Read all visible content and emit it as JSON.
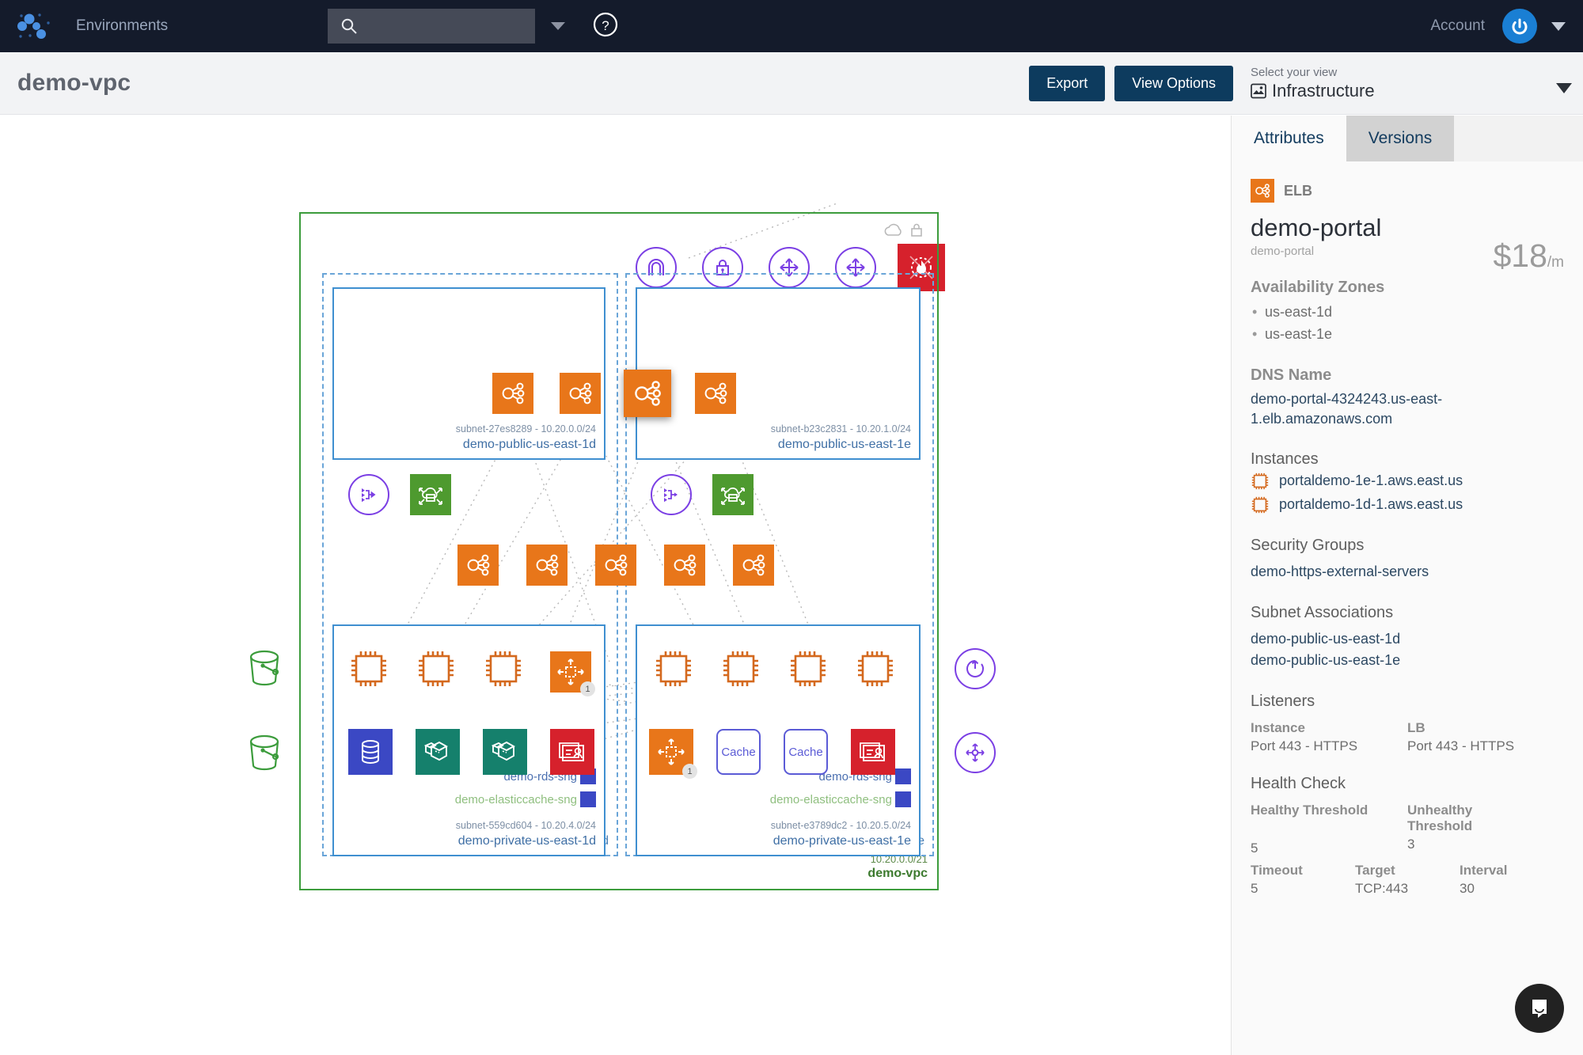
{
  "topnav": {
    "brand_icon": "network-logo-icon",
    "environments_label": "Environments",
    "search_placeholder": "",
    "search_value": "",
    "help_icon": "question-circle-icon",
    "account_label": "Account",
    "avatar_icon": "user-avatar-icon"
  },
  "subheader": {
    "title": "demo-vpc",
    "export_label": "Export",
    "view_options_label": "View Options",
    "view_select_label": "Select your view",
    "view_select_value": "Infrastructure",
    "view_select_icon": "image-view-icon"
  },
  "left_controls": [
    {
      "name": "zoom-in-button",
      "glyph": "+"
    },
    {
      "name": "zoom-out-button",
      "glyph": "−"
    },
    {
      "name": "fit-to-screen-button",
      "glyph": "map-fit-icon"
    },
    {
      "name": "center-button",
      "glyph": "center-dot-icon"
    }
  ],
  "diagram": {
    "top_icons": [
      {
        "name": "internet-gateway-icon",
        "label": "Internet Gateway",
        "style": "purple-circle"
      },
      {
        "name": "vpn-gateway-icon",
        "label": "VPN Gateway",
        "style": "purple-circle"
      },
      {
        "name": "router-icon",
        "label": "Router",
        "style": "purple-circle"
      },
      {
        "name": "router-icon-2",
        "label": "Router",
        "style": "purple-circle"
      },
      {
        "name": "waf-firewall-icon",
        "label": "WAF",
        "style": "red-square"
      }
    ],
    "side_icons": [
      {
        "name": "s3-bucket-icon",
        "label": "S3 Bucket"
      },
      {
        "name": "s3-bucket-icon-2",
        "label": "S3 Bucket"
      },
      {
        "name": "elastic-ip-icon",
        "label": "Elastic IP"
      },
      {
        "name": "route-table-icon",
        "label": "Route Table"
      }
    ],
    "vpc": {
      "cidr": "10.20.0.0/21",
      "name": "demo-vpc",
      "corner_icons": [
        "cloud-icon",
        "lock-icon"
      ]
    },
    "elb_row_top": [
      {
        "name": "elb-1",
        "selected": false
      },
      {
        "name": "elb-2",
        "selected": false
      },
      {
        "name": "elb-3",
        "selected": true
      },
      {
        "name": "elb-4",
        "selected": false
      }
    ],
    "elb_row_mid": [
      {
        "name": "elb-5"
      },
      {
        "name": "elb-6"
      },
      {
        "name": "elb-7"
      },
      {
        "name": "elb-8"
      },
      {
        "name": "elb-9"
      }
    ],
    "availability_zones": [
      {
        "label": "us-east-1d",
        "public_subnet": {
          "id": "subnet-27es8289 - 10.20.0.0/24",
          "name": "demo-public-us-east-1d"
        },
        "private_subnet": {
          "id": "subnet-559cd604 - 10.20.4.0/24",
          "name": "demo-private-us-east-1d"
        },
        "public_resources": [
          {
            "name": "nat-gateway-icon",
            "style": "purple-circle"
          },
          {
            "name": "cloud-storage-icon",
            "style": "green-square"
          }
        ],
        "private_instances": [
          "ec2-instance",
          "ec2-instance",
          "ec2-instance"
        ],
        "autoscaling_badge": "1",
        "private_services": [
          "rds-database-icon",
          "ecs-container-icon",
          "ecs-container-icon",
          "directory-service-icon"
        ],
        "subnet_groups": [
          {
            "label": "demo-rds-sng",
            "icon": "rds-subnet-group-icon",
            "color": "#4a6fb0"
          },
          {
            "label": "demo-elasticcache-sng",
            "icon": "elasticache-subnet-group-icon",
            "color": "#8fbf7f"
          }
        ]
      },
      {
        "label": "us-east-1e",
        "public_subnet": {
          "id": "subnet-b23c2831 - 10.20.1.0/24",
          "name": "demo-public-us-east-1e"
        },
        "private_subnet": {
          "id": "subnet-e3789dc2 - 10.20.5.0/24",
          "name": "demo-private-us-east-1e"
        },
        "public_resources": [
          {
            "name": "nat-gateway-icon",
            "style": "purple-circle"
          },
          {
            "name": "cloud-storage-icon",
            "style": "green-square"
          }
        ],
        "private_instances": [
          "ec2-instance",
          "ec2-instance",
          "ec2-instance",
          "ec2-instance"
        ],
        "autoscaling_badge": "1",
        "private_services": [
          "autoscaling-group-icon",
          "cache-node",
          "cache-node",
          "directory-service-icon"
        ],
        "cache_label": "Cache",
        "subnet_groups": [
          {
            "label": "demo-rds-sng",
            "icon": "rds-subnet-group-icon",
            "color": "#4a6fb0"
          },
          {
            "label": "demo-elasticcache-sng",
            "icon": "elasticache-subnet-group-icon",
            "color": "#8fbf7f"
          }
        ]
      }
    ]
  },
  "panel": {
    "tabs": [
      {
        "label": "Attributes",
        "active": true
      },
      {
        "label": "Versions",
        "active": false
      }
    ],
    "resource_type": "ELB",
    "resource_type_icon": "elb-icon",
    "resource_name": "demo-portal",
    "resource_subname": "demo-portal",
    "price": "$18",
    "price_unit": "/m",
    "availability_zones_heading": "Availability Zones",
    "availability_zones": [
      "us-east-1d",
      "us-east-1e"
    ],
    "dns_heading": "DNS Name",
    "dns_value": "demo-portal-4324243.us-east-1.elb.amazonaws.com",
    "instances_heading": "Instances",
    "instances": [
      "portaldemo-1e-1.aws.east.us",
      "portaldemo-1d-1.aws.east.us"
    ],
    "security_groups_heading": "Security Groups",
    "security_groups": [
      "demo-https-external-servers"
    ],
    "subnet_assoc_heading": "Subnet Associations",
    "subnet_associations": [
      "demo-public-us-east-1d",
      "demo-public-us-east-1e"
    ],
    "listeners_heading": "Listeners",
    "listeners": [
      {
        "header": "Instance",
        "value": "Port 443 - HTTPS"
      },
      {
        "header": "LB",
        "value": "Port 443 - HTTPS"
      }
    ],
    "health_check_heading": "Health Check",
    "health_check_row1": [
      {
        "header": "Healthy Threshold",
        "value": "5"
      },
      {
        "header": "Unhealthy Threshold",
        "value": "3"
      }
    ],
    "health_check_row2": [
      {
        "header": "Timeout",
        "value": "5"
      },
      {
        "header": "Target",
        "value": "TCP:443"
      },
      {
        "header": "Interval",
        "value": "30"
      }
    ],
    "chat_icon": "chat-bubble-icon"
  },
  "colors": {
    "nav_bg": "#141b2b",
    "accent_blue": "#0d3b5e",
    "aws_orange": "#e8761a",
    "vpc_green": "#3c9c3c",
    "subnet_blue": "#3f8fd0",
    "purple": "#7b3fe4",
    "red": "#d6212c"
  }
}
